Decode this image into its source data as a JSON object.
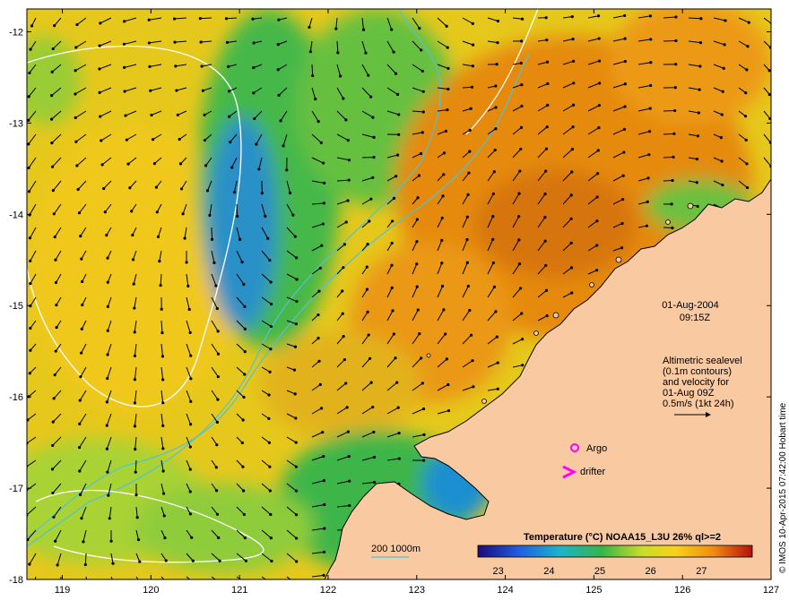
{
  "map": {
    "lon_ticks": [
      "119",
      "120",
      "121",
      "122",
      "123",
      "124",
      "125",
      "126",
      "127"
    ],
    "lat_ticks": [
      "-12",
      "-13",
      "-14",
      "-15",
      "-16",
      "-17",
      "-18"
    ],
    "lon_range": [
      118.6,
      127.0
    ],
    "lat_range": [
      -18.0,
      -11.75
    ]
  },
  "annotations": {
    "date": "01-Aug-2004",
    "time": "09:15Z",
    "altimetry_lines": [
      "Altimetric sealevel",
      "(0.1m contours)",
      "and velocity for",
      "01-Aug 09Z",
      "0.5m/s (1kt 24h)"
    ],
    "argo_label": "Argo",
    "drifter_label": "drifter",
    "bathy_label": "200  1000m"
  },
  "colorbar": {
    "title": "Temperature (°C) NOAA15_L3U 26% ql>=2",
    "ticks": [
      "23",
      "24",
      "25",
      "26",
      "27"
    ],
    "range": [
      22.6,
      28.0
    ]
  },
  "credit": "© IMOS 10-Apr-2015 07:42:00 Hobart time",
  "colors": {
    "land": "#f9c9a1",
    "warm": "#e58a10",
    "mid": "#f0c81e",
    "cool": "#34b54a",
    "cold": "#1e7fd0",
    "bathy": "#4fc3d6",
    "sealevel_contour": "#ffffff",
    "marker": "#ff00ff"
  }
}
